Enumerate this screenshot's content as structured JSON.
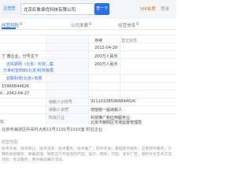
{
  "header": {
    "logo_text": "企查查",
    "search_value": "北京红象承优科技有限公司",
    "search_button": "查一下",
    "vip_label": "VIP会员",
    "vip_sub": "登录"
  },
  "tabs": [
    "经营风险",
    "0",
    "公司发展",
    "0",
    "经营信息",
    "0"
  ],
  "table": {
    "rows": [
      {
        "label": "",
        "value": "",
        "label2": "登记状态",
        "value2": "存续"
      },
      {
        "label": "",
        "value": "",
        "label2": "成立日期",
        "value2": "2012-04-20"
      },
      {
        "label": "",
        "value": "了 泰企业，分号注下",
        "label2": "注册资本",
        "value2": "200万人民币"
      },
      {
        "label": "",
        "value": "迈实顾网（北京）科技…集",
        "label2": "实缴资本",
        "value2": "200万人民币"
      },
      {
        "label": "",
        "value": "万世纪曾商知(北京)科技有限",
        "label2": "",
        "value2": ""
      },
      {
        "label": "",
        "value": "亚联科技(北京)·有限",
        "label2": "组织机构代码",
        "value2": ""
      },
      {
        "label": "",
        "value": "",
        "label2": "",
        "value2": ""
      },
      {
        "label": "",
        "value": "0 - 2042-04-27",
        "label2": "纳税人识别号",
        "value2": "91110108596684462K"
      },
      {
        "label": "",
        "value": "",
        "label2": "纳税人资质",
        "value2": "增值税一般纳税人"
      },
      {
        "label": "",
        "value": "",
        "label2": "所属行业",
        "value2": "科技推广和应用服务业"
      },
      {
        "label": "",
        "value": "",
        "label2": "登记机关",
        "value2": "北京市朝阳区市场监督管理局"
      }
    ],
    "left_codes": [
      "1596684462K",
      "",
      "",
      "北"
    ]
  },
  "registered_address": "北京市海淀区中关村大街11号1101号1010室  附近企业",
  "scope": {
    "label": "经营范围",
    "text": "技术开发、技术转让、技术咨询、技术服务、技术推广；软件开发；基础软件服务；应用软件服务；计算机系统服务；数据处理；销售自行开发后的产品；设计、制作、代理、发布广告；组织文化艺术交流活动；会议服务；承办展览展示活动。"
  }
}
